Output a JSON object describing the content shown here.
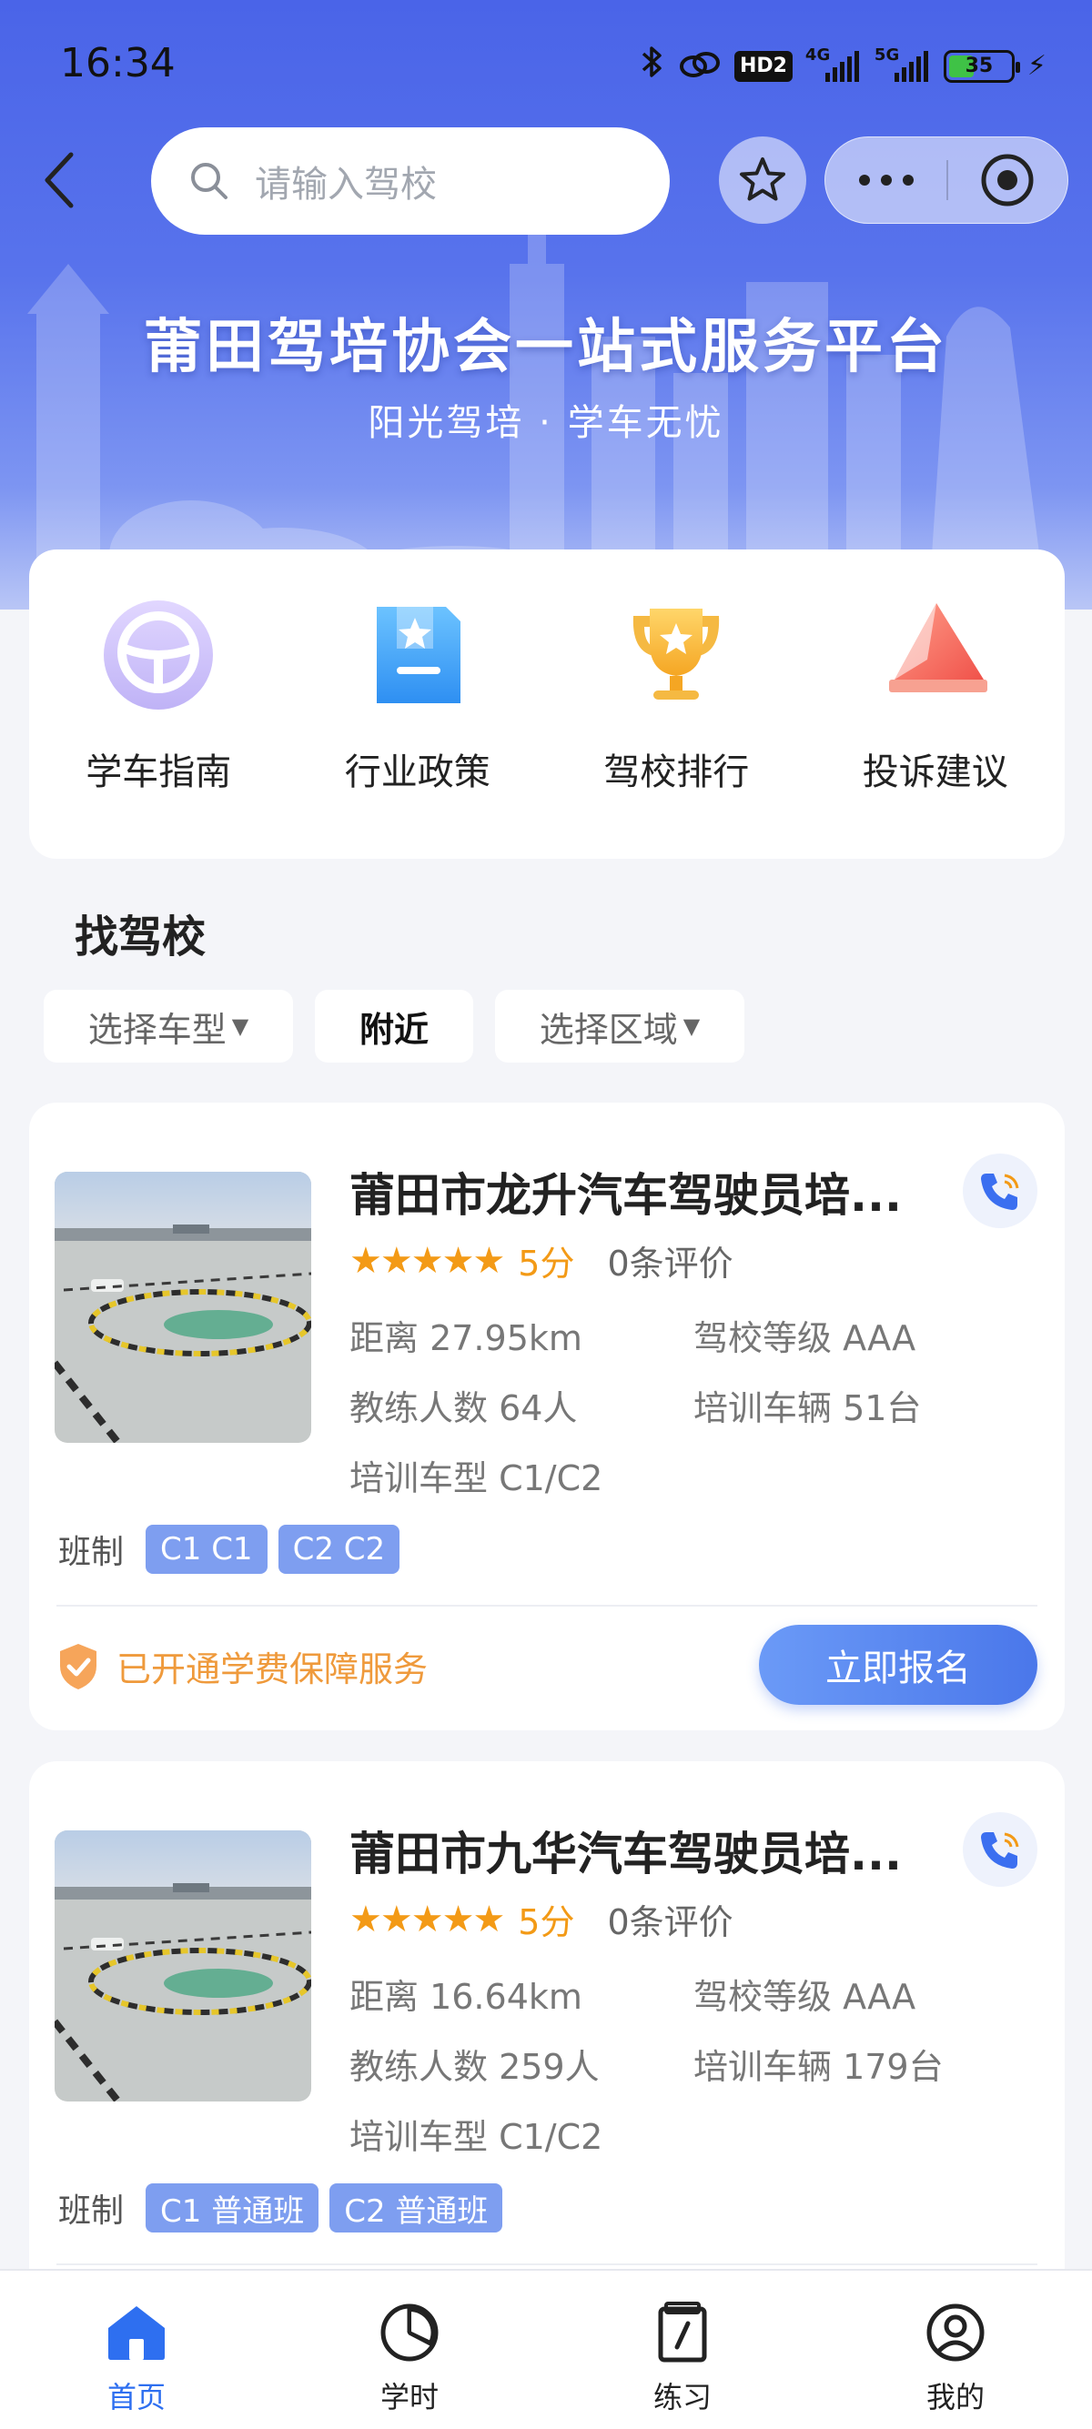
{
  "status_bar": {
    "time": "16:34",
    "network_hd": "HD2",
    "signal_1": "4G",
    "signal_2": "5G",
    "battery": "35",
    "icons": [
      "bluetooth-icon",
      "link-icon",
      "hd-icon",
      "signal-4g-icon",
      "signal-5g-icon",
      "battery-icon",
      "charging-icon"
    ]
  },
  "header": {
    "search_placeholder": "请输入驾校",
    "banner_title": "莆田驾培协会一站式服务平台",
    "banner_subtitle": "阳光驾培 · 学车无忧",
    "accent_color": "#4a64e8"
  },
  "quick_menu": [
    {
      "label": "学车指南",
      "icon": "steering-wheel-icon"
    },
    {
      "label": "行业政策",
      "icon": "policy-document-icon"
    },
    {
      "label": "驾校排行",
      "icon": "trophy-icon"
    },
    {
      "label": "投诉建议",
      "icon": "complaint-envelope-icon"
    }
  ],
  "find_school": {
    "title": "找驾校",
    "filters": {
      "car_type": "选择车型",
      "nearby": "附近",
      "region": "选择区域"
    }
  },
  "schools": [
    {
      "name": "莆田市龙升汽车驾驶员培...",
      "stars": "★★★★★",
      "score": "5分",
      "reviews": "0条评价",
      "distance": "距离 27.95km",
      "level": "驾校等级 AAA",
      "coaches": "教练人数 64人",
      "vehicles": "培训车辆 51台",
      "car_types": "培训车型 C1/C2",
      "class_label": "班制",
      "classes": [
        "C1 C1",
        "C2 C2"
      ],
      "guarantee": "已开通学费保障服务",
      "apply": "立即报名"
    },
    {
      "name": "莆田市九华汽车驾驶员培...",
      "stars": "★★★★★",
      "score": "5分",
      "reviews": "0条评价",
      "distance": "距离 16.64km",
      "level": "驾校等级 AAA",
      "coaches": "教练人数 259人",
      "vehicles": "培训车辆 179台",
      "car_types": "培训车型 C1/C2",
      "class_label": "班制",
      "classes": [
        "C1 普通班",
        "C2 普通班"
      ]
    }
  ],
  "tabbar": [
    {
      "label": "首页",
      "icon": "home-icon",
      "active": true
    },
    {
      "label": "学时",
      "icon": "pie-chart-icon",
      "active": false
    },
    {
      "label": "练习",
      "icon": "notebook-icon",
      "active": false
    },
    {
      "label": "我的",
      "icon": "user-icon",
      "active": false
    }
  ],
  "colors": {
    "primary": "#2e6ff0",
    "star": "#f39a16",
    "tag": "#7e9ef0",
    "guarantee": "#ef9a3c"
  }
}
